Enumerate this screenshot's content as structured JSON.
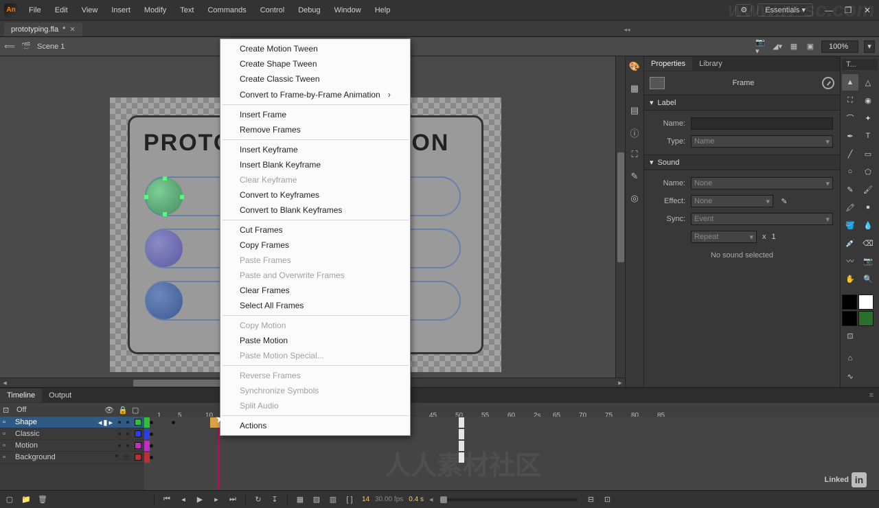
{
  "menu": {
    "items": [
      "File",
      "Edit",
      "View",
      "Insert",
      "Modify",
      "Text",
      "Commands",
      "Control",
      "Debug",
      "Window",
      "Help"
    ]
  },
  "workspace": "Essentials",
  "doc_tab": {
    "name": "prototyping.fla",
    "dirty": "*"
  },
  "scene": {
    "name": "Scene 1",
    "zoom": "100%"
  },
  "stage": {
    "title": "PROTOTYPE ANIMATION"
  },
  "context_menu": {
    "groups": [
      [
        {
          "label": "Create Motion Tween",
          "enabled": true
        },
        {
          "label": "Create Shape Tween",
          "enabled": true
        },
        {
          "label": "Create Classic Tween",
          "enabled": true
        },
        {
          "label": "Convert to Frame-by-Frame Animation",
          "enabled": true,
          "submenu": true
        }
      ],
      [
        {
          "label": "Insert Frame",
          "enabled": true
        },
        {
          "label": "Remove Frames",
          "enabled": true
        }
      ],
      [
        {
          "label": "Insert Keyframe",
          "enabled": true
        },
        {
          "label": "Insert Blank Keyframe",
          "enabled": true
        },
        {
          "label": "Clear Keyframe",
          "enabled": false
        },
        {
          "label": "Convert to Keyframes",
          "enabled": true
        },
        {
          "label": "Convert to Blank Keyframes",
          "enabled": true
        }
      ],
      [
        {
          "label": "Cut Frames",
          "enabled": true
        },
        {
          "label": "Copy Frames",
          "enabled": true
        },
        {
          "label": "Paste Frames",
          "enabled": false
        },
        {
          "label": "Paste and Overwrite Frames",
          "enabled": false
        },
        {
          "label": "Clear Frames",
          "enabled": true
        },
        {
          "label": "Select All Frames",
          "enabled": true
        }
      ],
      [
        {
          "label": "Copy Motion",
          "enabled": false
        },
        {
          "label": "Paste Motion",
          "enabled": true
        },
        {
          "label": "Paste Motion Special...",
          "enabled": false
        }
      ],
      [
        {
          "label": "Reverse Frames",
          "enabled": false
        },
        {
          "label": "Synchronize Symbols",
          "enabled": false
        },
        {
          "label": "Split Audio",
          "enabled": false
        }
      ],
      [
        {
          "label": "Actions",
          "enabled": true
        }
      ]
    ]
  },
  "properties": {
    "tabs": [
      "Properties",
      "Library"
    ],
    "object": "Frame",
    "label": {
      "section": "Label",
      "name_label": "Name:",
      "name_value": "",
      "type_label": "Type:",
      "type_value": "Name"
    },
    "sound": {
      "section": "Sound",
      "name_label": "Name:",
      "name_value": "None",
      "effect_label": "Effect:",
      "effect_value": "None",
      "sync_label": "Sync:",
      "sync_value": "Event",
      "repeat_value": "Repeat",
      "repeat_x": "x",
      "repeat_count": "1",
      "none_text": "No sound selected"
    }
  },
  "tools": {
    "head": "T..."
  },
  "timeline": {
    "tabs": [
      "Timeline",
      "Output"
    ],
    "onion": "Off",
    "ruler": [
      "1",
      "5",
      "10",
      "",
      "",
      "",
      "",
      "",
      "",
      "",
      "",
      "2s",
      "65",
      "70",
      "75",
      "80",
      "85"
    ],
    "ruler_left": [
      "45",
      "50",
      "55",
      "60"
    ],
    "layers": [
      {
        "name": "Shape",
        "selected": true,
        "color": "#2fbf3a"
      },
      {
        "name": "Classic",
        "selected": false,
        "color": "#2a3fe0"
      },
      {
        "name": "Motion",
        "selected": false,
        "color": "#c02fc0"
      },
      {
        "name": "Background",
        "selected": false,
        "color": "#c02f2f",
        "locked": true
      }
    ],
    "status": {
      "frame": "14",
      "fps": "30.00 fps",
      "time": "0.4 s"
    }
  },
  "watermarks": {
    "top": "www.rr-sc.com",
    "zh": "人人素材社区",
    "linkedin": "Linked"
  }
}
